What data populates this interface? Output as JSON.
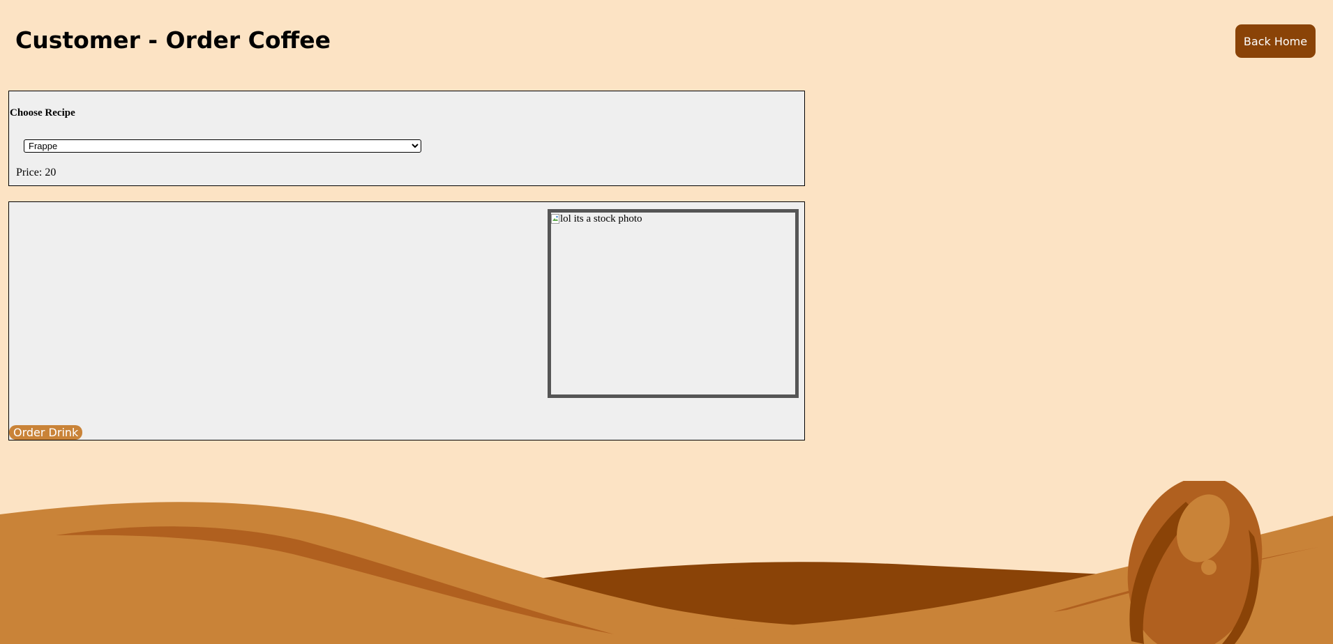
{
  "page": {
    "title": "Customer - Order Coffee",
    "back_home_label": "Back Home"
  },
  "recipe": {
    "heading": "Choose Recipe",
    "selected": "Frappe",
    "options": [
      "Frappe"
    ],
    "price_label": "Price:",
    "price_value": "20"
  },
  "order": {
    "photo_alt": "lol its a stock photo",
    "order_button_label": "Order Drink"
  },
  "icons": {
    "photo": "broken-image-icon",
    "decoration": "coffee-bean-icon"
  },
  "colors": {
    "page_background": "#fce3c4",
    "accent_dark": "#8a4307",
    "accent": "#c98338",
    "panel_background": "#efefef"
  }
}
